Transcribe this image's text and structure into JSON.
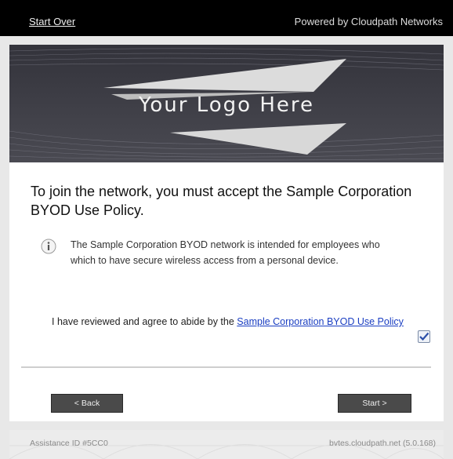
{
  "topbar": {
    "start_over": "Start Over",
    "powered_by": "Powered by Cloudpath Networks"
  },
  "banner": {
    "logo_text": "Your Logo Here"
  },
  "main": {
    "headline": "To join the network, you must accept the Sample Corporation BYOD Use Policy.",
    "info_text": "The Sample Corporation BYOD network is intended for employees who which to have secure wireless access from a personal device.",
    "agree_prefix": "I have reviewed and agree to abide by the",
    "policy_link": "Sample Corporation BYOD Use Policy",
    "agree_checked": true
  },
  "buttons": {
    "back": "< Back",
    "start": "Start >"
  },
  "footer": {
    "assistance_id": "Assistance ID #5CC0",
    "host": "bvtes.cloudpath.net (5.0.168)"
  },
  "colors": {
    "topbar": "#000000",
    "link": "#1a3ec2",
    "button": "#4a4a4a"
  }
}
